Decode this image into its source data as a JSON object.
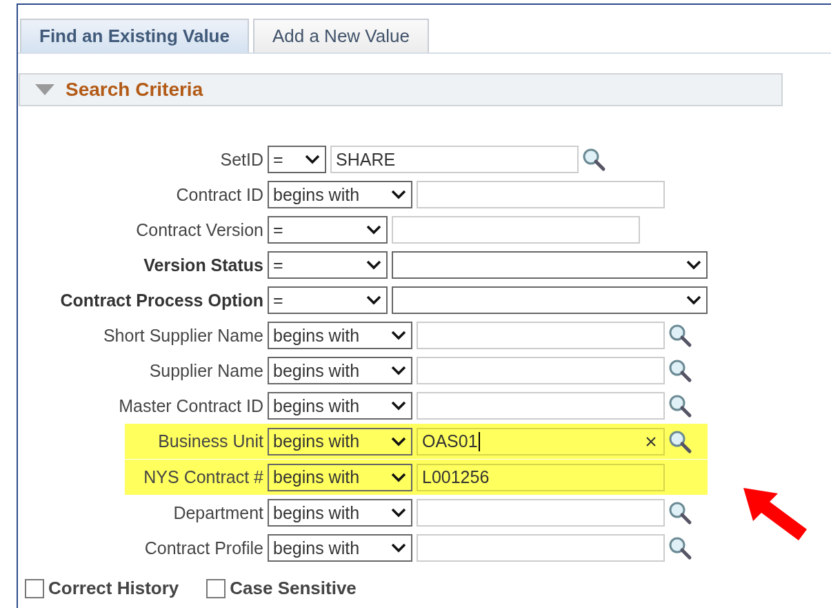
{
  "tabs": [
    {
      "label": "Find an Existing Value",
      "selected": true
    },
    {
      "label": "Add a New Value",
      "selected": false
    }
  ],
  "section": {
    "title": "Search Criteria",
    "expanded": true
  },
  "fields": [
    {
      "label": "SetID",
      "bold": false,
      "operator": "=",
      "kind": "text",
      "value": "SHARE",
      "lookup": true,
      "highlighted": false
    },
    {
      "label": "Contract ID",
      "bold": false,
      "operator": "begins with",
      "kind": "text",
      "lookup": false,
      "highlighted": false
    },
    {
      "label": "Contract Version",
      "bold": false,
      "operator": "=",
      "kind": "text",
      "lookup": false,
      "highlighted": false
    },
    {
      "label": "Version Status",
      "bold": true,
      "operator": "=",
      "kind": "dropdown",
      "highlighted": false
    },
    {
      "label": "Contract Process Option",
      "bold": true,
      "operator": "=",
      "kind": "dropdown",
      "highlighted": false
    },
    {
      "label": "Short Supplier Name",
      "bold": false,
      "operator": "begins with",
      "kind": "text",
      "lookup": true,
      "highlighted": false
    },
    {
      "label": "Supplier Name",
      "bold": false,
      "operator": "begins with",
      "kind": "text",
      "lookup": true,
      "highlighted": false
    },
    {
      "label": "Master Contract ID",
      "bold": false,
      "operator": "begins with",
      "kind": "text",
      "lookup": true,
      "highlighted": false
    },
    {
      "label": "Business Unit",
      "bold": false,
      "operator": "begins with",
      "kind": "text",
      "value": "OAS01",
      "lookup": true,
      "highlighted": true,
      "clear": true,
      "cursor": true
    },
    {
      "label": "NYS Contract #",
      "bold": false,
      "operator": "begins with",
      "kind": "text",
      "value": "L001256",
      "lookup": false,
      "highlighted": true
    },
    {
      "label": "Department",
      "bold": false,
      "operator": "begins with",
      "kind": "text",
      "lookup": true,
      "highlighted": false
    },
    {
      "label": "Contract Profile",
      "bold": false,
      "operator": "begins with",
      "kind": "text",
      "lookup": true,
      "highlighted": false
    }
  ],
  "options": [
    {
      "label": "Correct History",
      "checked": false
    },
    {
      "label": "Case Sensitive",
      "checked": false
    }
  ],
  "annotation": {
    "kind": "arrow",
    "color": "#ff0000"
  }
}
